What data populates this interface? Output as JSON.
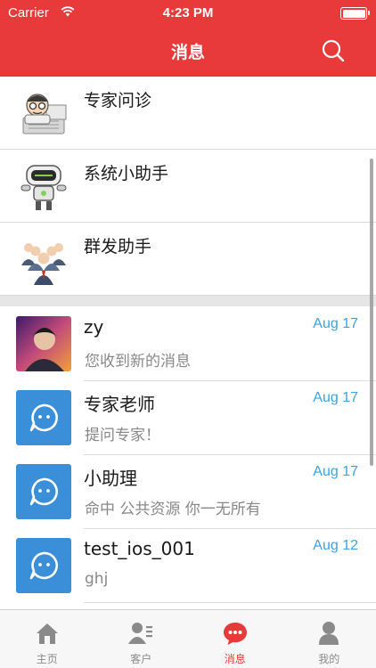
{
  "status_bar": {
    "carrier": "Carrier",
    "time": "4:23 PM"
  },
  "nav": {
    "title": "消息"
  },
  "system_rows": [
    {
      "label": "专家问诊",
      "icon": "doctor-icon"
    },
    {
      "label": "系统小助手",
      "icon": "robot-icon"
    },
    {
      "label": "群发助手",
      "icon": "group-people-icon"
    }
  ],
  "messages": [
    {
      "name": "zy",
      "date": "Aug 17",
      "preview": "您收到新的消息",
      "avatar": "user-photo"
    },
    {
      "name": "专家老师",
      "date": "Aug 17",
      "preview": "提问专家！",
      "avatar": "chat-bubble-icon"
    },
    {
      "name": "小助理",
      "date": "Aug 17",
      "preview": "命中  公共资源  你一无所有",
      "avatar": "chat-bubble-icon"
    },
    {
      "name": "test_ios_001",
      "date": "Aug 12",
      "preview": "ghj",
      "avatar": "chat-bubble-icon"
    }
  ],
  "tabs": [
    {
      "label": "主页",
      "icon": "home-icon",
      "active": false
    },
    {
      "label": "客户",
      "icon": "customers-icon",
      "active": false
    },
    {
      "label": "消息",
      "icon": "message-icon",
      "active": true
    },
    {
      "label": "我的",
      "icon": "profile-icon",
      "active": false
    }
  ],
  "colors": {
    "brand": "#e8393b",
    "date": "#3aa3e3",
    "bubble": "#3b8fd8"
  }
}
